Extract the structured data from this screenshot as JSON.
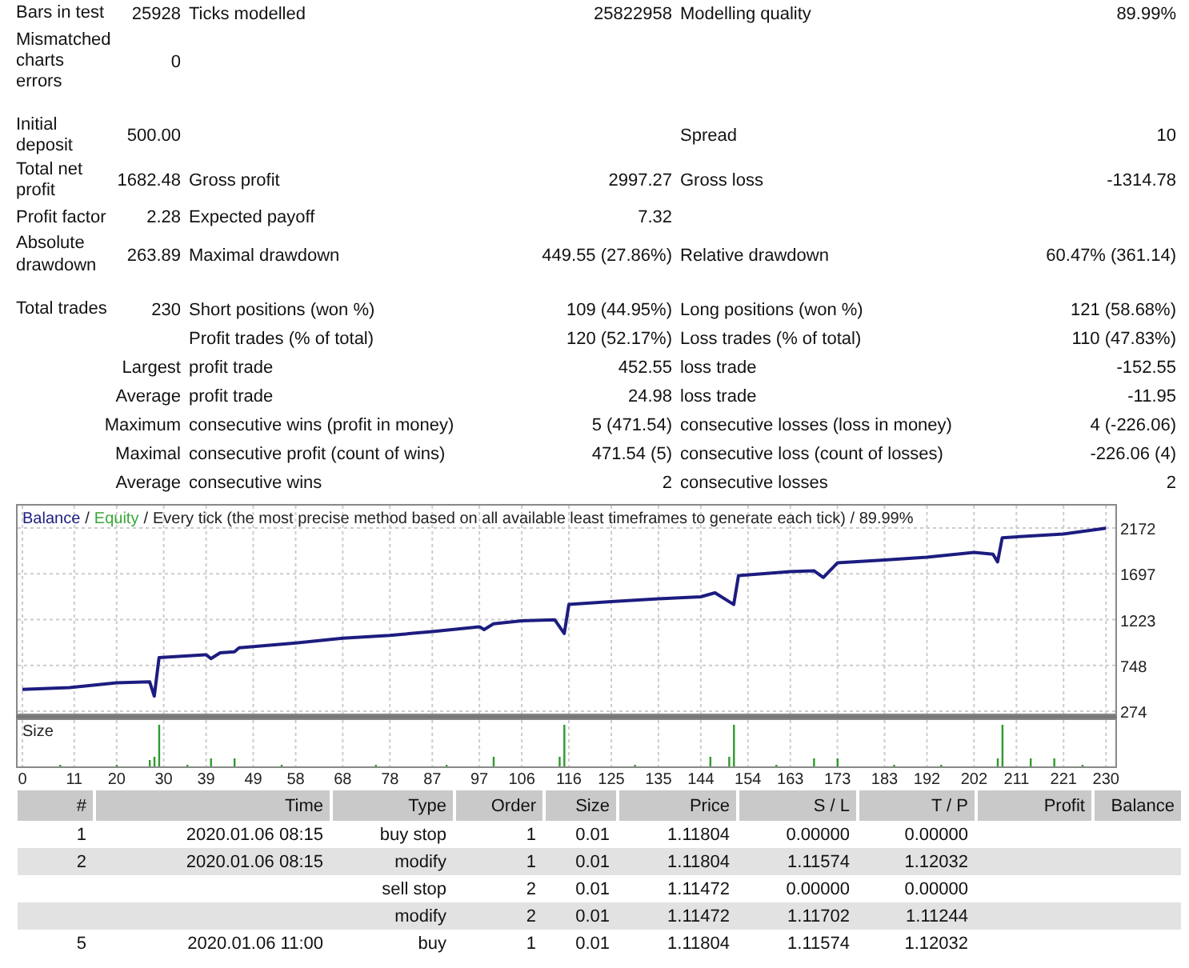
{
  "summary": {
    "sections": [
      [
        {
          "label_1": "Bars in test",
          "value_1": "25928",
          "label_2": "Ticks modelled",
          "value_2": "25822958",
          "label_3": "Modelling quality",
          "value_3": "89.99%"
        },
        {
          "label_1": "Mismatched charts errors",
          "value_1": "0"
        }
      ],
      [
        {
          "label_1": "Initial deposit",
          "value_1": "500.00",
          "label_3": "Spread",
          "value_3": "10"
        },
        {
          "label_1": "Total net profit",
          "value_1": "1682.48",
          "label_2": "Gross profit",
          "value_2": "2997.27",
          "label_3": "Gross loss",
          "value_3": "-1314.78"
        },
        {
          "label_1": "Profit factor",
          "value_1": "2.28",
          "label_2": "Expected payoff",
          "value_2": "7.32"
        },
        {
          "label_1": "Absolute drawdown",
          "value_1": "263.89",
          "label_2": "Maximal drawdown",
          "value_2": "449.55 (27.86%)",
          "label_3": "Relative drawdown",
          "value_3": "60.47% (361.14)"
        }
      ],
      [
        {
          "label_1": "Total trades",
          "value_1": "230",
          "label_2": "Short positions (won %)",
          "value_2": "109 (44.95%)",
          "label_3": "Long positions (won %)",
          "value_3": "121 (58.68%)"
        },
        {
          "label_2": "Profit trades (% of total)",
          "value_2": "120 (52.17%)",
          "label_3": "Loss trades (% of total)",
          "value_3": "110 (47.83%)"
        },
        {
          "group": "Largest",
          "label_2": "profit trade",
          "value_2": "452.55",
          "label_3": "loss trade",
          "value_3": "-152.55"
        },
        {
          "group": "Average",
          "label_2": "profit trade",
          "value_2": "24.98",
          "label_3": "loss trade",
          "value_3": "-11.95"
        },
        {
          "group": "Maximum",
          "label_2": "consecutive wins (profit in money)",
          "value_2": "5 (471.54)",
          "label_3": "consecutive losses (loss in money)",
          "value_3": "4 (-226.06)"
        },
        {
          "group": "Maximal",
          "label_2": "consecutive profit (count of wins)",
          "value_2": "471.54 (5)",
          "label_3": "consecutive loss (count of losses)",
          "value_3": "-226.06 (4)"
        },
        {
          "group": "Average",
          "label_2": "consecutive wins",
          "value_2": "2",
          "label_3": "consecutive losses",
          "value_3": "2"
        }
      ]
    ]
  },
  "chart": {
    "separator": "/",
    "equity_label": {
      "label": "Equity",
      "color": "#3aa83a"
    },
    "title": "Every tick (the most precise method based on all available least timeframes to generate each tick) / 89.99%",
    "size_label": "Size",
    "chart_data": {
      "type": "line",
      "grid": true,
      "xlim": [
        0,
        232
      ],
      "ylim": [
        250,
        2420
      ],
      "yticks": [
        274,
        748,
        1223,
        1697,
        2172
      ],
      "xticks": [
        0,
        11,
        20,
        30,
        39,
        49,
        58,
        68,
        78,
        87,
        97,
        106,
        116,
        125,
        135,
        144,
        154,
        163,
        173,
        183,
        192,
        202,
        211,
        221,
        230
      ],
      "x": [
        0,
        10,
        20,
        27,
        28,
        29,
        39,
        40,
        42,
        45,
        46,
        58,
        68,
        78,
        87,
        97,
        98,
        100,
        106,
        113,
        115,
        116,
        125,
        135,
        144,
        147,
        151,
        152,
        163,
        168,
        170,
        173,
        183,
        192,
        202,
        206,
        207,
        208,
        221,
        230
      ],
      "series": [
        {
          "name": "Balance",
          "color": "#1c1c80",
          "values": [
            500,
            520,
            570,
            580,
            430,
            830,
            860,
            820,
            880,
            890,
            930,
            980,
            1030,
            1060,
            1100,
            1150,
            1120,
            1180,
            1210,
            1220,
            1080,
            1380,
            1410,
            1440,
            1460,
            1500,
            1380,
            1680,
            1720,
            1730,
            1660,
            1810,
            1840,
            1870,
            1920,
            1900,
            1820,
            2070,
            2110,
            2170
          ]
        }
      ]
    }
  },
  "trades": {
    "columns": [
      "#",
      "Time",
      "Type",
      "Order",
      "Size",
      "Price",
      "S / L",
      "T / P",
      "Profit",
      "Balance"
    ],
    "rows": [
      {
        "cells": [
          "1",
          "2020.01.06 08:15",
          "buy stop",
          "1",
          "0.01",
          "1.11804",
          "0.00000",
          "0.00000"
        ]
      },
      {
        "cells": [
          "2",
          "2020.01.06 08:15",
          "modify",
          "1",
          "0.01",
          "1.11804",
          "1.11574",
          "1.12032"
        ]
      },
      {
        "cells": [
          null,
          null,
          "sell stop",
          "2",
          "0.01",
          "1.11472",
          "0.00000",
          "0.00000"
        ]
      },
      {
        "cells": [
          null,
          null,
          "modify",
          "2",
          "0.01",
          "1.11472",
          "1.11702",
          "1.11244"
        ]
      },
      {
        "cells": [
          "5",
          "2020.01.06 11:00",
          "buy",
          "1",
          "0.01",
          "1.11804",
          "1.11574",
          "1.12032"
        ]
      }
    ]
  }
}
